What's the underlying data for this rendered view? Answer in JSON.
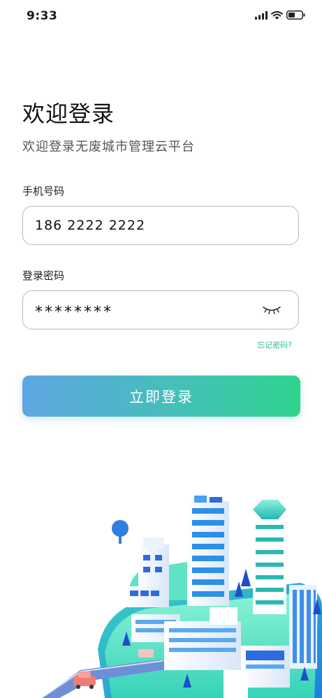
{
  "status_bar": {
    "time": "9:33",
    "icons": [
      "cellular-signal-icon",
      "wifi-icon",
      "battery-icon"
    ]
  },
  "login": {
    "title": "欢迎登录",
    "subtitle": "欢迎登录无废城市管理云平台",
    "phone_label": "手机号码",
    "phone_value": "186 2222 2222",
    "password_label": "登录密码",
    "password_value": "********",
    "forgot_label": "忘记密码?",
    "submit_label": "立即登录",
    "password_toggle_icon": "eye-closed-icon"
  },
  "colors": {
    "accent_green": "#2ebf8a",
    "button_gradient_start": "#5ea6e3",
    "button_gradient_end": "#2fd490"
  },
  "illustration": {
    "icon": "smart-city-illustration"
  }
}
